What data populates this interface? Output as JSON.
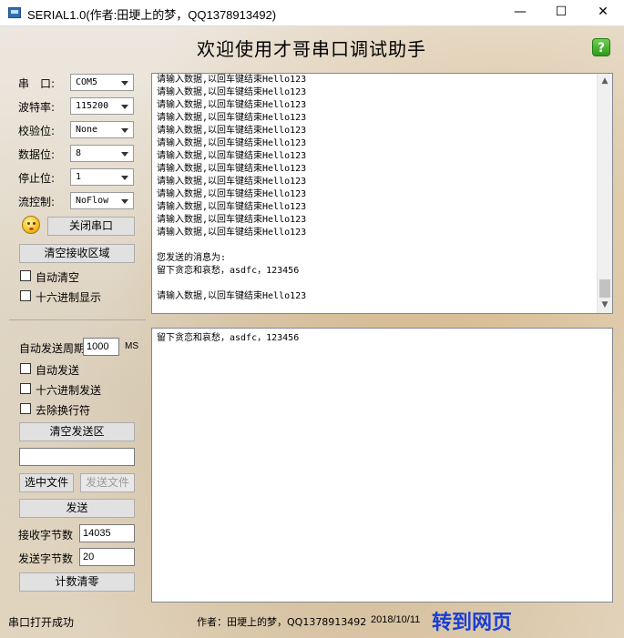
{
  "window": {
    "title": "SERIAL1.0(作者:田埂上的梦，QQ1378913492)",
    "minimize": "—",
    "maximize": "☐",
    "close": "✕"
  },
  "heading": "欢迎使用才哥串口调试助手",
  "help_icon": "?",
  "settings": {
    "port": {
      "label": "串　口:",
      "value": "COM5"
    },
    "baud": {
      "label": "波特率:",
      "value": "115200"
    },
    "parity": {
      "label": "校验位:",
      "value": "None"
    },
    "databits": {
      "label": "数据位:",
      "value": "8"
    },
    "stopbits": {
      "label": "停止位:",
      "value": "1"
    },
    "flow": {
      "label": "流控制:",
      "value": "NoFlow"
    }
  },
  "close_port_button": "关闭串口",
  "clear_receive_button": "清空接收区域",
  "auto_clear_label": "自动清空",
  "hex_display_label": "十六进制显示",
  "receive_text": "请输入数据,以回车键结束Hello123\n请输入数据,以回车键结束Hello123\n请输入数据,以回车键结束Hello123\n请输入数据,以回车键结束Hello123\n请输入数据,以回车键结束Hello123\n请输入数据,以回车键结束Hello123\n请输入数据,以回车键结束Hello123\n请输入数据,以回车键结束Hello123\n请输入数据,以回车键结束Hello123\n请输入数据,以回车键结束Hello123\n请输入数据,以回车键结束Hello123\n请输入数据,以回车键结束Hello123\n请输入数据,以回车键结束Hello123\n请输入数据,以回车键结束Hello123\n\n您发送的消息为:\n留下贪恋和哀愁，asdfc，123456\n\n请输入数据,以回车键结束Hello123",
  "send_text": "留下贪恋和哀愁，asdfc，123456",
  "auto_send": {
    "period_label": "自动发送周期",
    "period_value": "1000",
    "unit": "MS"
  },
  "auto_send_label": "自动发送",
  "hex_send_label": "十六进制发送",
  "strip_newline_label": "去除换行符",
  "clear_send_button": "清空发送区",
  "file_path_value": "",
  "select_file_button": "选中文件",
  "send_file_button": "发送文件",
  "send_button": "发送",
  "rx_count": {
    "label": "接收字节数",
    "value": "14035"
  },
  "tx_count": {
    "label": "发送字节数",
    "value": "20"
  },
  "reset_count_button": "计数清零",
  "status_text": "串口打开成功",
  "footer": {
    "author": "作者：田埂上的梦，QQ1378913492",
    "date": "2018/10/11",
    "link": "转到网页"
  },
  "colors": {
    "link": "#1a3fd6",
    "help_icon": "#3aa52a"
  }
}
